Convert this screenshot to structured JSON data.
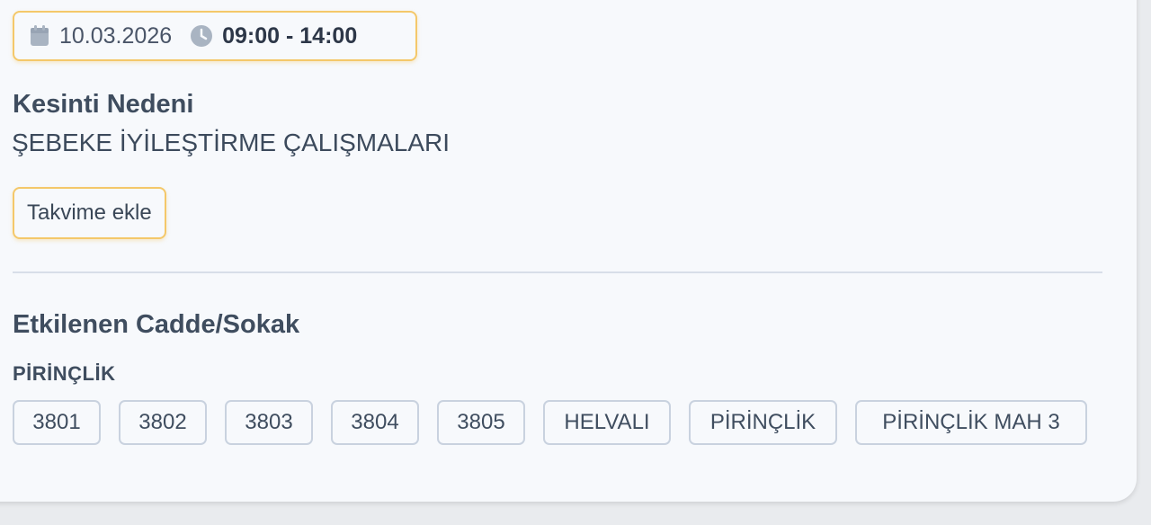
{
  "schedule": {
    "date": "10.03.2026",
    "time_range": "09:00 - 14:00",
    "calendar_icon": "calendar-icon",
    "clock_icon": "clock-icon"
  },
  "reason": {
    "heading": "Kesinti Nedeni",
    "value": "ŞEBEKE İYİLEŞTİRME ÇALIŞMALARI"
  },
  "actions": {
    "add_to_calendar_label": "Takvime ekle"
  },
  "affected": {
    "heading": "Etkilenen Cadde/Sokak",
    "neighborhood": "PİRİNÇLİK",
    "streets": [
      "3801",
      "3802",
      "3803",
      "3804",
      "3805",
      "HELVALI",
      "PİRİNÇLİK",
      "PİRİNÇLİK MAH 3"
    ]
  },
  "colors": {
    "accent_border": "#f4c86a",
    "tag_border": "#c9d2df",
    "text_primary": "#3f4d5f"
  }
}
